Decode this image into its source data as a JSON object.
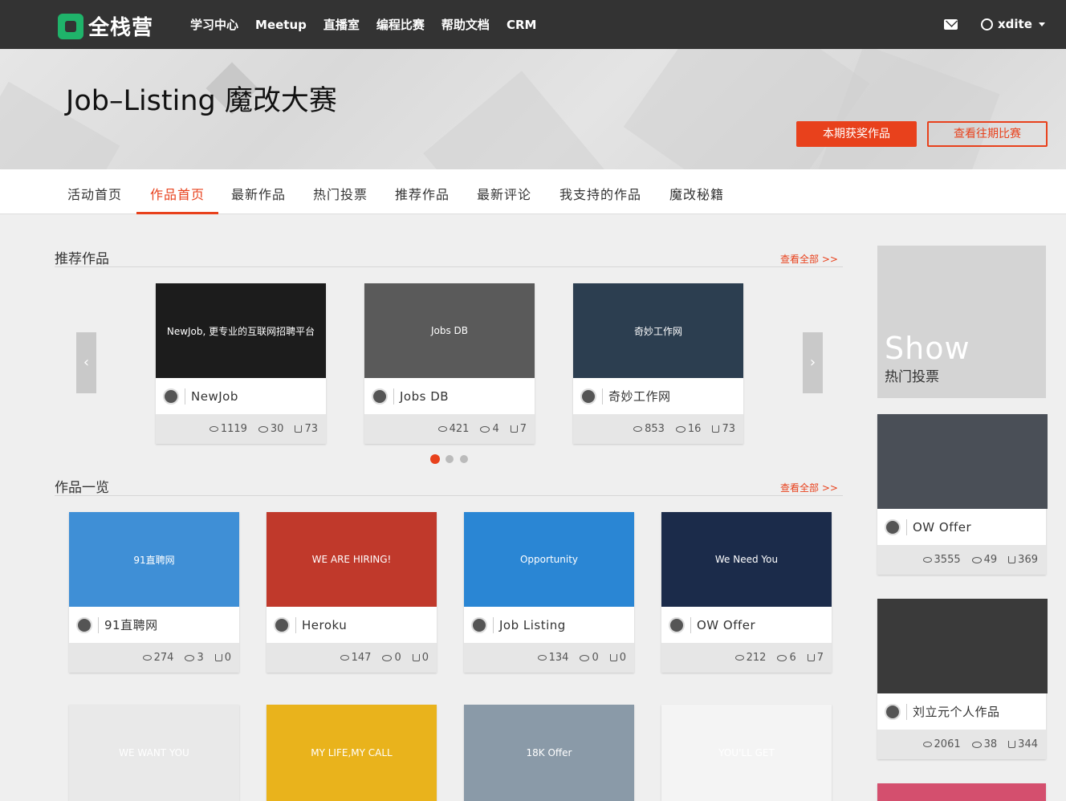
{
  "header": {
    "logo_text": "全栈营",
    "nav": [
      "学习中心",
      "Meetup",
      "直播室",
      "编程比赛",
      "帮助文档",
      "CRM"
    ],
    "username": "xdite"
  },
  "banner": {
    "title": "Job–Listing 魔改大赛",
    "btn_awards": "本期获奖作品",
    "btn_past": "查看往期比赛"
  },
  "tabs": [
    "活动首页",
    "作品首页",
    "最新作品",
    "热门投票",
    "推荐作品",
    "最新评论",
    "我支持的作品",
    "魔改秘籍"
  ],
  "active_tab": "作品首页",
  "featured": {
    "title": "推荐作品",
    "more": "查看全部 >>",
    "cards": [
      {
        "name": "NewJob",
        "views": "1119",
        "comments": "30",
        "likes": "73",
        "thumb_text": "NewJob, 更专业的互联网招聘平台",
        "thumb_color": "#1c1c1c"
      },
      {
        "name": "Jobs DB",
        "views": "421",
        "comments": "4",
        "likes": "7",
        "thumb_text": "Jobs DB",
        "thumb_color": "#5a5a5a"
      },
      {
        "name": "奇妙工作网",
        "views": "853",
        "comments": "16",
        "likes": "73",
        "thumb_text": "奇妙工作网",
        "thumb_color": "#2c3e50"
      }
    ]
  },
  "list": {
    "title": "作品一览",
    "more": "查看全部 >>",
    "cards": [
      {
        "name": "91直聘网",
        "views": "274",
        "comments": "3",
        "likes": "0",
        "thumb_text": "91直聘网",
        "thumb_color": "#3f8fd6"
      },
      {
        "name": "Heroku",
        "views": "147",
        "comments": "0",
        "likes": "0",
        "thumb_text": "WE ARE HIRING!",
        "thumb_color": "#c0392b"
      },
      {
        "name": "Job Listing",
        "views": "134",
        "comments": "0",
        "likes": "0",
        "thumb_text": "Opportunity",
        "thumb_color": "#2a86d4"
      },
      {
        "name": "OW Offer",
        "views": "212",
        "comments": "6",
        "likes": "7",
        "thumb_text": "We Need You",
        "thumb_color": "#1b2b4a"
      }
    ],
    "row2": [
      {
        "thumb_text": "WE WANT YOU",
        "thumb_color": "#e9e9e9"
      },
      {
        "thumb_text": "MY LIFE,MY CALL",
        "thumb_color": "#e9b31c"
      },
      {
        "thumb_text": "18K Offer",
        "thumb_color": "#8a9aa8"
      },
      {
        "thumb_text": "YOU'LL GET",
        "thumb_color": "#f4f4f4"
      }
    ]
  },
  "sidebar": {
    "show_big": "Show",
    "show_small": "热门投票",
    "cards": [
      {
        "name": "OW Offer",
        "views": "3555",
        "comments": "49",
        "likes": "369",
        "thumb_color": "#4a4f57"
      },
      {
        "name": "刘立元个人作品",
        "views": "2061",
        "comments": "38",
        "likes": "344",
        "thumb_color": "#3a3a3a"
      }
    ]
  }
}
